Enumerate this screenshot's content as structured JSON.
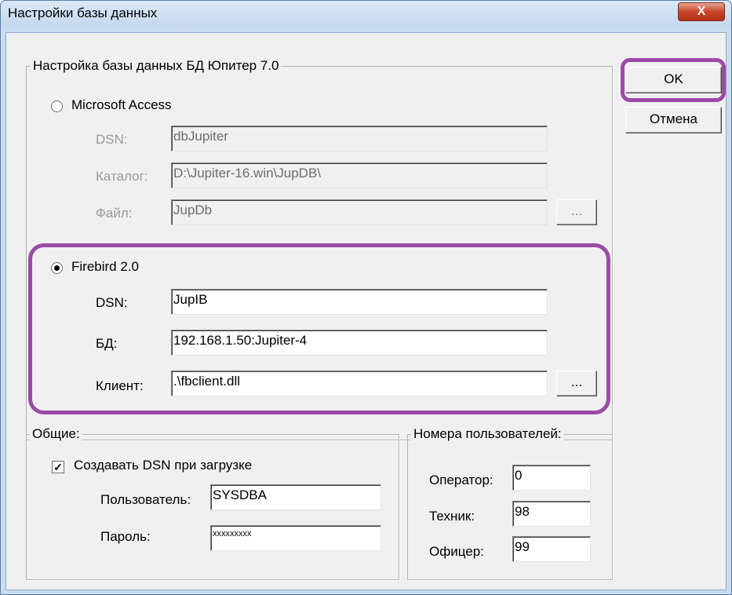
{
  "window": {
    "title": "Настройки базы данных",
    "close_glyph": "X"
  },
  "buttons": {
    "ok": "OK",
    "cancel": "Отмена",
    "browse": "..."
  },
  "db_group": {
    "legend": "Настройка базы данных БД Юпитер 7.0",
    "access": {
      "label": "Microsoft Access",
      "selected": false,
      "dsn_label": "DSN:",
      "dsn": "dbJupiter",
      "catalog_label": "Каталог:",
      "catalog": "D:\\Jupiter-16.win\\JupDB\\",
      "file_label": "Файл:",
      "file": "JupDb"
    },
    "firebird": {
      "label": "Firebird 2.0",
      "selected": true,
      "dsn_label": "DSN:",
      "dsn": "JupIB",
      "db_label": "БД:",
      "db": "192.168.1.50:Jupiter-4",
      "client_label": "Клиент:",
      "client": ".\\fbclient.dll"
    }
  },
  "general": {
    "legend": "Общие:",
    "create_dsn_label": "Создавать DSN при загрузке",
    "create_dsn_checked": true,
    "user_label": "Пользователь:",
    "user": "SYSDBA",
    "password_label": "Пароль:",
    "password": "xxxxxxxxx"
  },
  "user_numbers": {
    "legend": "Номера пользователей:",
    "operator_label": "Оператор:",
    "operator": "0",
    "tech_label": "Техник:",
    "tech": "98",
    "officer_label": "Офицер:",
    "officer": "99"
  },
  "colors": {
    "highlight": "#9b4ba5",
    "close_button": "#c7452a",
    "title_bar": "#c9dcf0"
  }
}
